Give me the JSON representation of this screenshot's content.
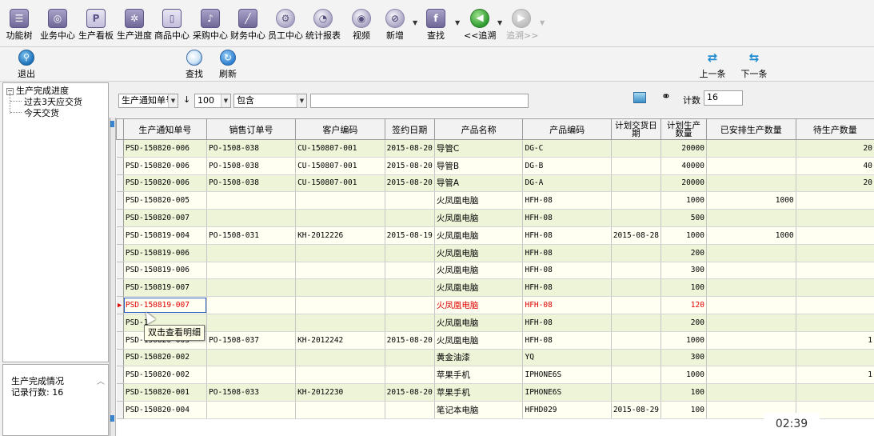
{
  "toolbar": {
    "items": [
      {
        "label": "功能树",
        "icon": "function-tree-icon"
      },
      {
        "label": "业务中心",
        "icon": "business-center-icon"
      },
      {
        "label": "生产看板",
        "icon": "production-board-icon"
      },
      {
        "label": "生产进度",
        "icon": "production-progress-icon"
      },
      {
        "label": "商品中心",
        "icon": "goods-center-icon"
      },
      {
        "label": "采购中心",
        "icon": "purchase-center-icon"
      },
      {
        "label": "财务中心",
        "icon": "finance-center-icon"
      },
      {
        "label": "员工中心",
        "icon": "staff-center-icon"
      },
      {
        "label": "统计报表",
        "icon": "statistics-report-icon"
      },
      {
        "label": "视频",
        "icon": "video-icon"
      },
      {
        "label": "新增",
        "icon": "add-icon"
      },
      {
        "label": "查找",
        "icon": "search-icon"
      },
      {
        "label": "<<追溯",
        "icon": "back-trace-icon"
      },
      {
        "label": "追溯>>",
        "icon": "forward-trace-icon"
      }
    ]
  },
  "toolbar2": {
    "exit": "退出",
    "find": "查找",
    "refresh": "刷新",
    "prev": "上一条",
    "next": "下一条"
  },
  "tree": {
    "root": "生产完成进度",
    "children": [
      "过去3天应交货",
      "今天交货"
    ]
  },
  "info": {
    "title": "生产完成情况",
    "count": "记录行数: 16"
  },
  "filter": {
    "field": "生产通知单号",
    "sort_arrow": "↓",
    "limit": "100",
    "operator": "包含",
    "value": "",
    "count_label": "计数",
    "count_value": "16"
  },
  "grid": {
    "columns": [
      "生产通知单号",
      "销售订单号",
      "客户编码",
      "签约日期",
      "产品名称",
      "产品编码",
      "计划交货日期",
      "计划生产数量",
      "已安排生产数量",
      "待生产数量"
    ],
    "rows": [
      [
        "PSD-150820-006",
        "PO-1508-038",
        "CU-150807-001",
        "2015-08-20",
        "导管C",
        "DG-C",
        "",
        "20000",
        "",
        "20"
      ],
      [
        "PSD-150820-006",
        "PO-1508-038",
        "CU-150807-001",
        "2015-08-20",
        "导管B",
        "DG-B",
        "",
        "40000",
        "",
        "40"
      ],
      [
        "PSD-150820-006",
        "PO-1508-038",
        "CU-150807-001",
        "2015-08-20",
        "导管A",
        "DG-A",
        "",
        "20000",
        "",
        "20"
      ],
      [
        "PSD-150820-005",
        "",
        "",
        "",
        "火凤凰电脑",
        "HFH-08",
        "",
        "1000",
        "1000",
        ""
      ],
      [
        "PSD-150820-007",
        "",
        "",
        "",
        "火凤凰电脑",
        "HFH-08",
        "",
        "500",
        "",
        ""
      ],
      [
        "PSD-150819-004",
        "PO-1508-031",
        "KH-2012226",
        "2015-08-19",
        "火凤凰电脑",
        "HFH-08",
        "2015-08-28",
        "1000",
        "1000",
        ""
      ],
      [
        "PSD-150819-006",
        "",
        "",
        "",
        "火凤凰电脑",
        "HFH-08",
        "",
        "200",
        "",
        ""
      ],
      [
        "PSD-150819-006",
        "",
        "",
        "",
        "火凤凰电脑",
        "HFH-08",
        "",
        "300",
        "",
        ""
      ],
      [
        "PSD-150819-007",
        "",
        "",
        "",
        "火凤凰电脑",
        "HFH-08",
        "",
        "100",
        "",
        ""
      ],
      [
        "PSD-150819-007",
        "",
        "",
        "",
        "火凤凰电脑",
        "HFH-08",
        "",
        "120",
        "",
        ""
      ],
      [
        "PSD-1",
        "",
        "",
        "",
        "火凤凰电脑",
        "HFH-08",
        "",
        "200",
        "",
        ""
      ],
      [
        "PSD-150820-003",
        "PO-1508-037",
        "KH-2012242",
        "2015-08-20",
        "火凤凰电脑",
        "HFH-08",
        "",
        "1000",
        "",
        "1"
      ],
      [
        "PSD-150820-002",
        "",
        "",
        "",
        "黄金油漆",
        "YQ",
        "",
        "300",
        "",
        ""
      ],
      [
        "PSD-150820-002",
        "",
        "",
        "",
        "苹果手机",
        "IPHONE6S",
        "",
        "1000",
        "",
        "1"
      ],
      [
        "PSD-150820-001",
        "PO-1508-033",
        "KH-2012230",
        "2015-08-20",
        "苹果手机",
        "IPHONE6S",
        "",
        "100",
        "",
        ""
      ],
      [
        "PSD-150820-004",
        "",
        "",
        "",
        "笔记本电脑",
        "HFHD029",
        "2015-08-29",
        "100",
        "",
        ""
      ]
    ],
    "current_row": 9
  },
  "tooltip": "双击查看明细",
  "clock": "02:39"
}
